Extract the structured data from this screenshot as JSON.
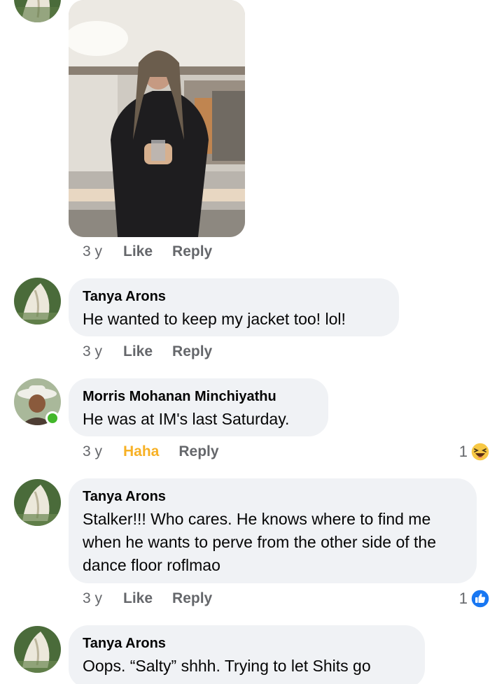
{
  "photo_comment": {
    "time": "3 y",
    "like_label": "Like",
    "reply_label": "Reply"
  },
  "comments": [
    {
      "author": "Tanya Arons",
      "text": "He wanted to keep my jacket too!  lol!",
      "time": "3 y",
      "reaction_label": "Like",
      "reply_label": "Reply",
      "reaction_count": ""
    },
    {
      "author": "Morris Mohanan Minchiyathu",
      "text": "He was at IM's last Saturday.",
      "time": "3 y",
      "reaction_label": "Haha",
      "reply_label": "Reply",
      "reaction_count": "1",
      "reaction_icon": "haha-emoji-icon",
      "online": true
    },
    {
      "author": "Tanya Arons",
      "text": "Stalker!!! Who cares.  He knows where to find me when he wants to perve from the other side of the dance floor roflmao",
      "time": "3 y",
      "reaction_label": "Like",
      "reply_label": "Reply",
      "reaction_count": "1",
      "reaction_icon": "thumbs-up-icon"
    },
    {
      "author": "Tanya Arons",
      "text": "Oops. “Salty” shhh. Trying to let Shits go",
      "time": "",
      "reaction_label": "",
      "reply_label": "",
      "reaction_count": ""
    }
  ],
  "colors": {
    "bubble": "#f0f2f5",
    "secondary_text": "#65676b",
    "haha": "#f7b125",
    "like_blue": "#1877f2",
    "online": "#42b72a"
  }
}
